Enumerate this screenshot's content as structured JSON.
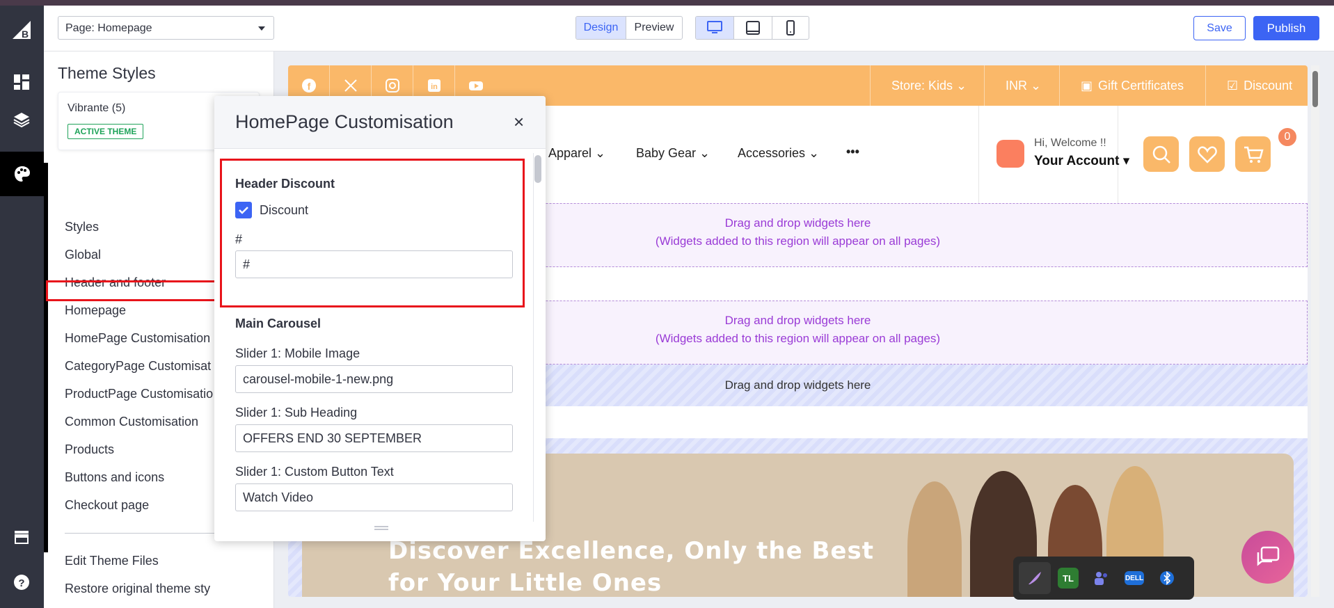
{
  "toolbar": {
    "page_select": "Page: Homepage",
    "design": "Design",
    "preview": "Preview",
    "save": "Save",
    "publish": "Publish"
  },
  "theme_panel": {
    "title": "Theme Styles",
    "theme_name": "Vibrante (5)",
    "theme_badge": "ACTIVE THEME",
    "menu": [
      "Styles",
      "Global",
      "Header and footer",
      "Homepage",
      "HomePage Customisation",
      "CategoryPage Customisat",
      "ProductPage Customisatio",
      "Common Customisation",
      "Products",
      "Buttons and icons",
      "Checkout page",
      "Edit Theme Files",
      "Restore original theme sty"
    ]
  },
  "popup": {
    "title": "HomePage Customisation",
    "close": "×",
    "header_discount": "Header Discount",
    "discount_checkbox": "Discount",
    "discount_checked": true,
    "hash_label": "#",
    "hash_value": "#",
    "main_carousel": "Main Carousel",
    "slider1_mobile_label": "Slider 1: Mobile Image",
    "slider1_mobile_value": "carousel-mobile-1-new.png",
    "slider1_sub_label": "Slider 1: Sub Heading",
    "slider1_sub_value": "OFFERS END 30 SEPTEMBER",
    "slider1_btn_label": "Slider 1: Custom Button Text",
    "slider1_btn_value": "Watch Video"
  },
  "site": {
    "util": [
      "Store: Kids ⌄",
      "INR ⌄",
      "Gift Certificates",
      "Discount"
    ],
    "nav": [
      "Apparel ⌄",
      "Baby Gear ⌄",
      "Accessories ⌄",
      "•••"
    ],
    "account_hi": "Hi, Welcome !!",
    "account_name": "Your Account ▾",
    "cart_count": "0",
    "dz_line1": "Drag and drop widgets here",
    "dz_line2": "(Widgets added to this region will appear on all pages)",
    "dz_plain": "Drag and drop widgets here",
    "hero_line1": "Discover Excellence, Only the Best",
    "hero_line2": "for Your Little Ones"
  },
  "tray": [
    "TL",
    "DELL"
  ],
  "colors": {
    "accent": "#3c64f4",
    "orange": "#fab869",
    "highlight": "#e8141b",
    "dropzone_text": "#9a3bd6"
  }
}
